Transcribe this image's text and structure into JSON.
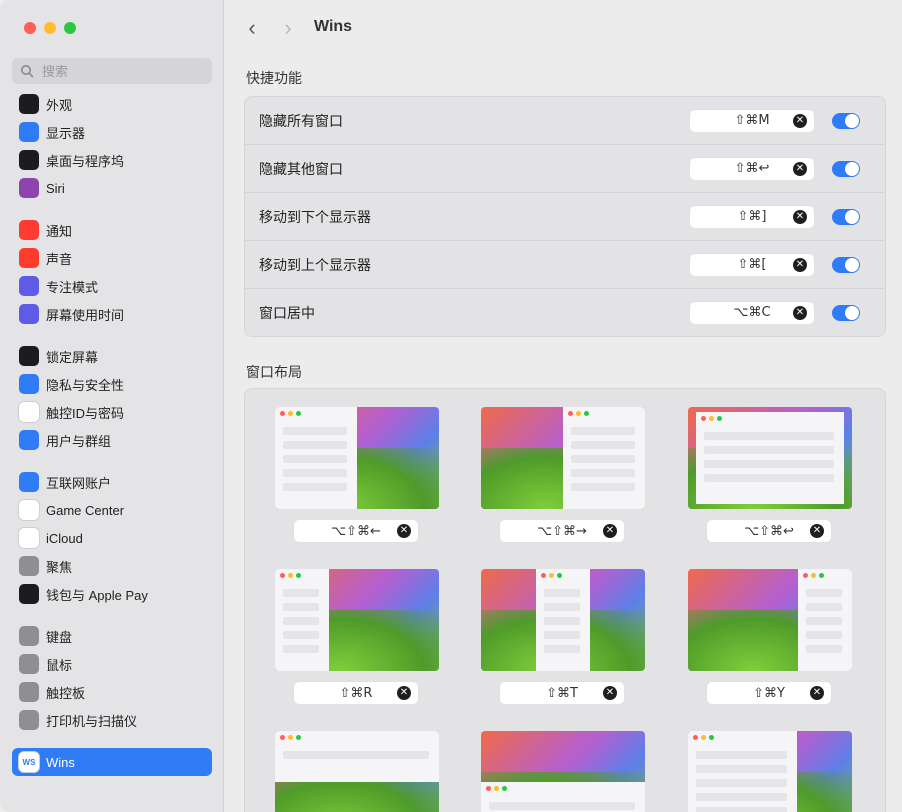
{
  "window": {
    "title": "Wins"
  },
  "search": {
    "placeholder": "搜索"
  },
  "sidebar": {
    "items": [
      {
        "label": "外观",
        "icon": "appearance-icon",
        "color": "#1c1c1e"
      },
      {
        "label": "显示器",
        "icon": "sun-icon",
        "color": "#2f7cf6"
      },
      {
        "label": "桌面与程序坞",
        "icon": "dock-icon",
        "color": "#1c1c1e"
      },
      {
        "label": "Siri",
        "icon": "siri-icon",
        "color": "#8e44ad"
      },
      {
        "label": "通知",
        "icon": "bell-icon",
        "color": "#ff3b30"
      },
      {
        "label": "声音",
        "icon": "speaker-icon",
        "color": "#ff3b30"
      },
      {
        "label": "专注模式",
        "icon": "moon-icon",
        "color": "#5e5ce6"
      },
      {
        "label": "屏幕使用时间",
        "icon": "hourglass-icon",
        "color": "#5e5ce6"
      },
      {
        "label": "锁定屏幕",
        "icon": "lock-icon",
        "color": "#1c1c1e"
      },
      {
        "label": "隐私与安全性",
        "icon": "hand-icon",
        "color": "#2f7cf6"
      },
      {
        "label": "触控ID与密码",
        "icon": "fingerprint-icon",
        "color": "#ffffff"
      },
      {
        "label": "用户与群组",
        "icon": "users-icon",
        "color": "#2f7cf6"
      },
      {
        "label": "互联网账户",
        "icon": "at-icon",
        "color": "#2f7cf6"
      },
      {
        "label": "Game Center",
        "icon": "game-center-icon",
        "color": "#ffffff"
      },
      {
        "label": "iCloud",
        "icon": "cloud-icon",
        "color": "#ffffff"
      },
      {
        "label": "聚焦",
        "icon": "magnifier-icon",
        "color": "#8e8e93"
      },
      {
        "label": "钱包与 Apple Pay",
        "icon": "wallet-icon",
        "color": "#1c1c1e"
      },
      {
        "label": "键盘",
        "icon": "keyboard-icon",
        "color": "#8e8e93"
      },
      {
        "label": "鼠标",
        "icon": "mouse-icon",
        "color": "#8e8e93"
      },
      {
        "label": "触控板",
        "icon": "trackpad-icon",
        "color": "#8e8e93"
      },
      {
        "label": "打印机与扫描仪",
        "icon": "printer-icon",
        "color": "#8e8e93"
      },
      {
        "label": "Wins",
        "icon": "wins-app-icon",
        "color": "#ffffff",
        "badge": "WS"
      }
    ]
  },
  "nav": {
    "back": "‹",
    "forward": "›"
  },
  "shortcuts": {
    "heading": "快捷功能",
    "rows": [
      {
        "label": "隐藏所有窗口",
        "keys": "⇧⌘M"
      },
      {
        "label": "隐藏其他窗口",
        "keys": "⇧⌘↩"
      },
      {
        "label": "移动到下个显示器",
        "keys": "⇧⌘]"
      },
      {
        "label": "移动到上个显示器",
        "keys": "⇧⌘["
      },
      {
        "label": "窗口居中",
        "keys": "⌥⌘C"
      }
    ]
  },
  "layouts": {
    "heading": "窗口布局",
    "items": [
      {
        "keys": "⌥⇧⌘←",
        "layout": "left-half"
      },
      {
        "keys": "⌥⇧⌘→",
        "layout": "right-half"
      },
      {
        "keys": "⌥⇧⌘↩",
        "layout": "maximize"
      },
      {
        "keys": "⇧⌘R",
        "layout": "left-third"
      },
      {
        "keys": "⇧⌘T",
        "layout": "center-third"
      },
      {
        "keys": "⇧⌘Y",
        "layout": "right-third"
      },
      {
        "layout": "top-half"
      },
      {
        "layout": "bottom-half"
      },
      {
        "layout": "right-two-thirds"
      }
    ]
  },
  "clear_glyph": "✕"
}
